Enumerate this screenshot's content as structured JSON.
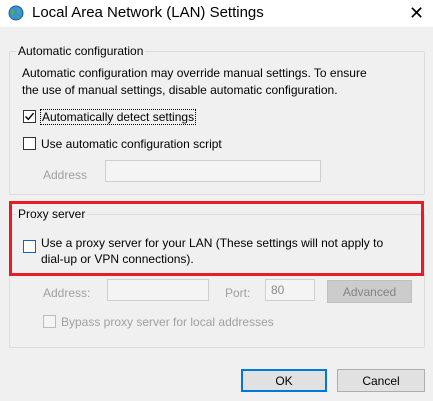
{
  "window": {
    "title": "Local Area Network (LAN) Settings",
    "close_glyph": "✕",
    "title_icon": "network-globe-icon"
  },
  "auto_config": {
    "group_label": "Automatic configuration",
    "description_line1": "Automatic configuration may override manual settings.  To ensure",
    "description_line2": "the use of manual settings, disable automatic configuration.",
    "auto_detect_label": "Automatically detect settings",
    "auto_detect_checked": true,
    "use_script_label": "Use automatic configuration script",
    "use_script_checked": false,
    "address_label": "Address",
    "address_value": ""
  },
  "proxy": {
    "group_label": "Proxy server",
    "use_proxy_line1": "Use a proxy server for your LAN (These settings will not apply to",
    "use_proxy_line2": "dial-up or VPN connections).",
    "use_proxy_checked": false,
    "address_label": "Address:",
    "address_value": "",
    "port_label": "Port:",
    "port_value": "80",
    "advanced_label": "Advanced",
    "bypass_label": "Bypass proxy server for local addresses",
    "bypass_checked": false,
    "highlight_color": "#e81c24"
  },
  "buttons": {
    "ok_label": "OK",
    "cancel_label": "Cancel"
  }
}
